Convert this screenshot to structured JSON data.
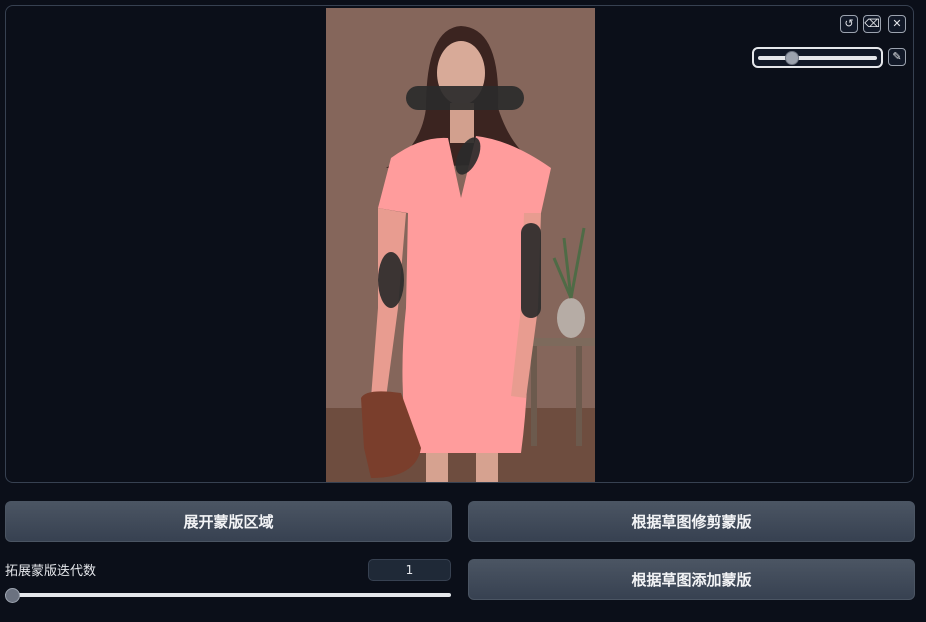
{
  "toolbar": {
    "undo_icon": "undo-icon",
    "eraser_icon": "eraser-icon",
    "close_icon": "close-icon",
    "brush_icon": "brush-icon",
    "brush_size_fraction": 0.27
  },
  "buttons": {
    "expand_mask": "展开蒙版区域",
    "trim_mask": "根据草图修剪蒙版",
    "add_mask": "根据草图添加蒙版"
  },
  "iterations": {
    "label": "拓展蒙版迭代数",
    "value": "1",
    "fraction": 0.0
  },
  "colors": {
    "mask_pink": "#ff9c9c",
    "background": "#0b0f19",
    "button": "#414b5a"
  }
}
